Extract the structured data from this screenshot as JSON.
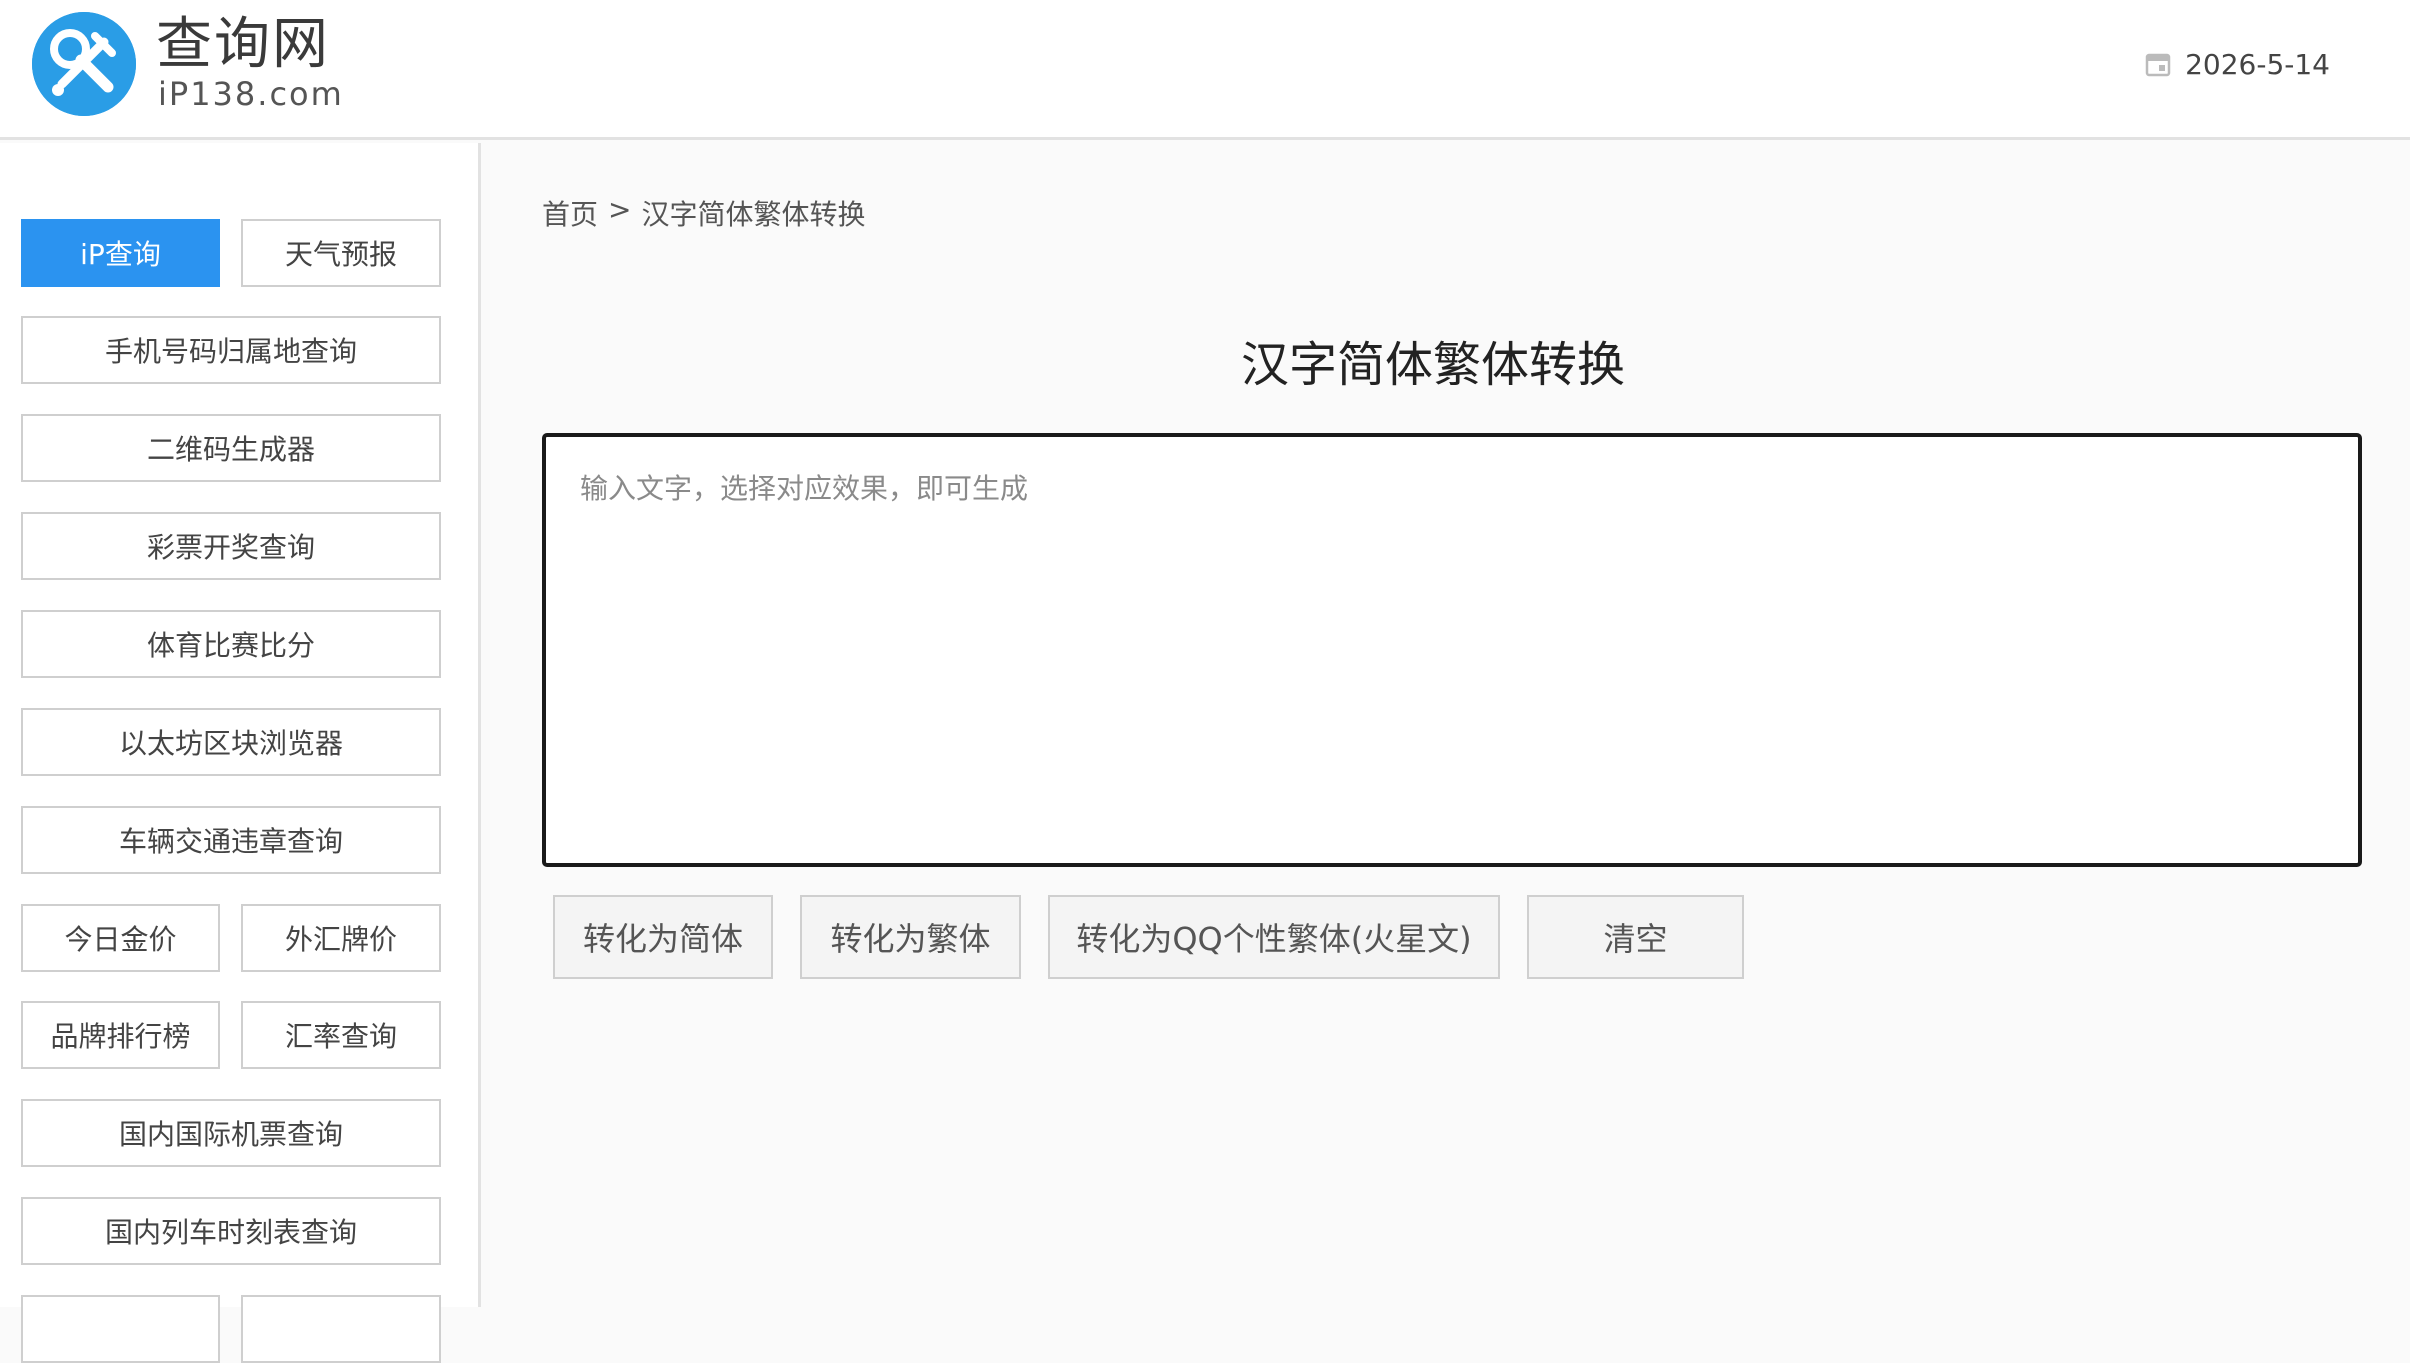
{
  "brand": {
    "title": "查询网",
    "subtitle": "iP138.com",
    "logo_icon": "tools-icon"
  },
  "header": {
    "date": "2026-5-14",
    "date_icon": "calendar-icon"
  },
  "sidebar": {
    "items": [
      {
        "label": "iP查询",
        "active": true
      },
      {
        "label": "天气预报"
      },
      {
        "label": "手机号码归属地查询"
      },
      {
        "label": "二维码生成器"
      },
      {
        "label": "彩票开奖查询"
      },
      {
        "label": "体育比赛比分"
      },
      {
        "label": "以太坊区块浏览器"
      },
      {
        "label": "车辆交通违章查询"
      },
      {
        "label": "今日金价"
      },
      {
        "label": "外汇牌价"
      },
      {
        "label": "品牌排行榜"
      },
      {
        "label": "汇率查询"
      },
      {
        "label": "国内国际机票查询"
      },
      {
        "label": "国内列车时刻表查询"
      }
    ]
  },
  "breadcrumb": {
    "home": "首页",
    "separator": ">",
    "current": "汉字简体繁体转换"
  },
  "main": {
    "title": "汉字简体繁体转换",
    "input": {
      "value": "",
      "placeholder": "输入文字，选择对应效果，即可生成"
    },
    "buttons": {
      "to_simplified": "转化为简体",
      "to_traditional": "转化为繁体",
      "to_martian": "转化为QQ个性繁体(火星文)",
      "clear": "清空"
    }
  },
  "colors": {
    "accent": "#2b93f0",
    "logo": "#2a9de6",
    "border": "#cfcfcf"
  }
}
